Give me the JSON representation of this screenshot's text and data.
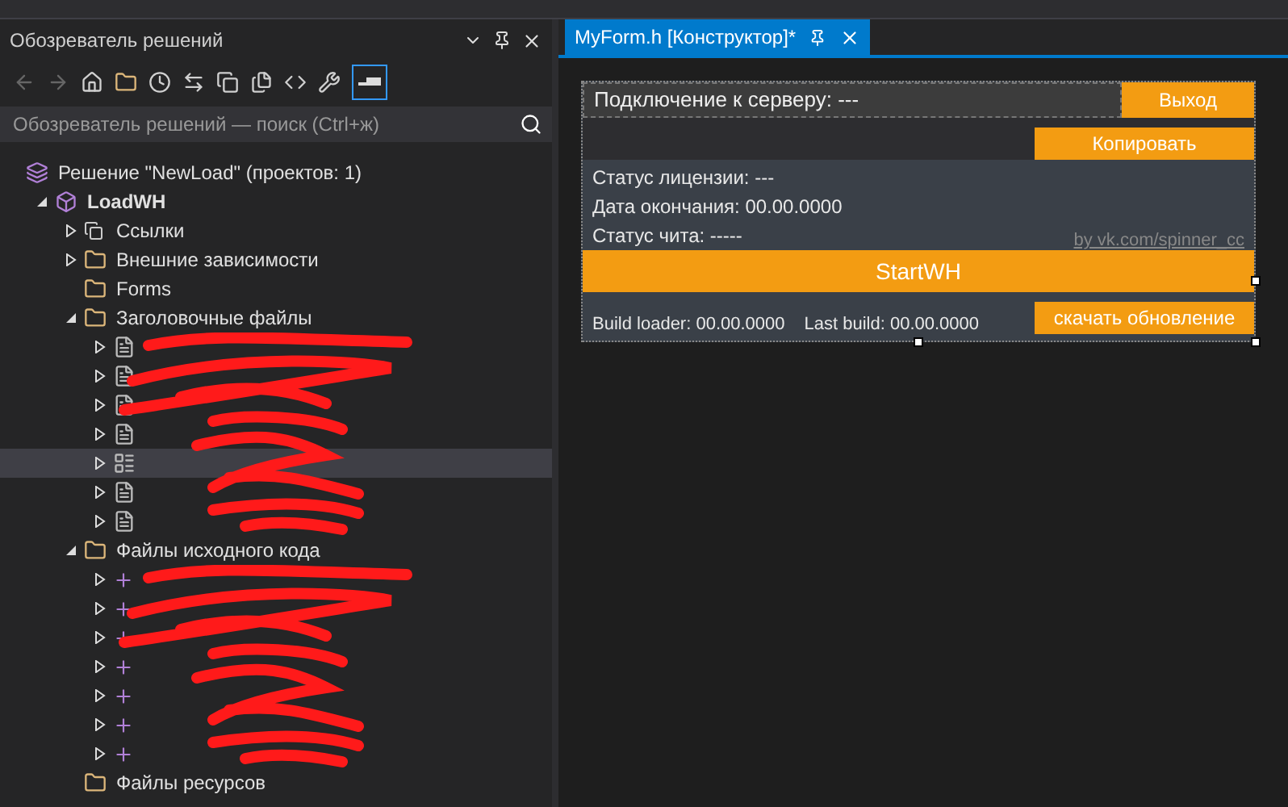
{
  "explorer": {
    "title": "Обозреватель решений",
    "search": {
      "placeholder": "Обозреватель решений — поиск (Ctrl+ж)"
    },
    "tree": [
      {
        "label": "Решение \"NewLoad\"  (проектов: 1)",
        "kind": "solution",
        "selected": false,
        "children": [
          {
            "label": "LoadWH",
            "kind": "project",
            "expanded": true,
            "selected": false,
            "children": [
              {
                "label": "Ссылки",
                "kind": "refs",
                "expanded": false,
                "selected": false
              },
              {
                "label": "Внешние зависимости",
                "kind": "deps",
                "expanded": false,
                "selected": false
              },
              {
                "label": "Forms",
                "kind": "folder",
                "selected": false
              },
              {
                "label": "Заголовочные файлы",
                "kind": "folder",
                "expanded": true,
                "selected": false,
                "redacted": true,
                "children": [
                  {
                    "kind": "header",
                    "expanded": false,
                    "selected": false
                  },
                  {
                    "kind": "header",
                    "expanded": false,
                    "selected": false
                  },
                  {
                    "kind": "header",
                    "expanded": false,
                    "selected": false
                  },
                  {
                    "kind": "header",
                    "expanded": false,
                    "selected": false
                  },
                  {
                    "kind": "form",
                    "expanded": false,
                    "selected": true
                  },
                  {
                    "kind": "header",
                    "expanded": false,
                    "selected": false
                  },
                  {
                    "kind": "header",
                    "expanded": false,
                    "selected": false
                  }
                ]
              },
              {
                "label": "Файлы исходного кода",
                "kind": "folder",
                "expanded": true,
                "selected": false,
                "redacted": true,
                "children": [
                  {
                    "kind": "cpp",
                    "expanded": false,
                    "selected": false
                  },
                  {
                    "kind": "cpp",
                    "expanded": false,
                    "selected": false
                  },
                  {
                    "kind": "cpp",
                    "expanded": false,
                    "selected": false
                  },
                  {
                    "kind": "cpp",
                    "expanded": false,
                    "selected": false
                  },
                  {
                    "kind": "cpp",
                    "expanded": false,
                    "selected": false
                  },
                  {
                    "kind": "cpp",
                    "expanded": false,
                    "selected": false
                  },
                  {
                    "kind": "cpp",
                    "expanded": false,
                    "selected": false
                  }
                ]
              },
              {
                "label": "Файлы ресурсов",
                "kind": "folder",
                "selected": false
              }
            ]
          }
        ]
      }
    ]
  },
  "editor": {
    "tab": {
      "label": "MyForm.h [Конструктор]*",
      "selected": true
    },
    "form": {
      "server_status": "Подключение к серверу: ---",
      "exit_button": "Выход",
      "copy_button": "Копировать",
      "status_lines": [
        "Статус лицензии:  ---",
        "Дата окончания: 00.00.0000",
        "Статус чита: -----"
      ],
      "link": "by vk.com/spinner_cc",
      "start_button": "StartWH",
      "build_loader": "Build loader: 00.00.0000",
      "last_build": "Last build: 00.00.0000",
      "update_button": "скачать обновление"
    }
  }
}
